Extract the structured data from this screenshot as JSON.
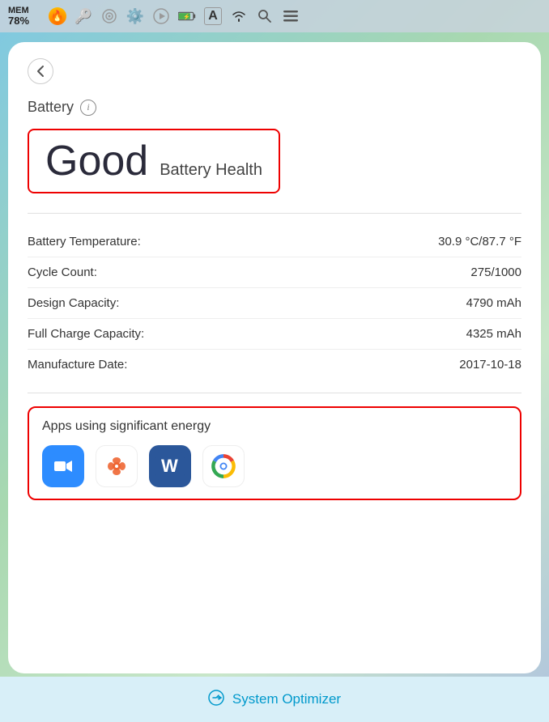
{
  "statusBar": {
    "mem": "MEM\n78%",
    "memLabel": "MEM",
    "memValue": "78%"
  },
  "header": {
    "backLabel": "‹",
    "title": "Battery",
    "infoIcon": "i"
  },
  "batteryHealth": {
    "status": "Good",
    "label": "Battery Health"
  },
  "stats": [
    {
      "label": "Battery Temperature:",
      "value": "30.9 °C/87.7 °F"
    },
    {
      "label": "Cycle Count:",
      "value": "275/1000"
    },
    {
      "label": "Design Capacity:",
      "value": "4790 mAh"
    },
    {
      "label": "Full Charge Capacity:",
      "value": "4325 mAh"
    },
    {
      "label": "Manufacture Date:",
      "value": "2017-10-18"
    }
  ],
  "appsSection": {
    "title": "Apps using significant energy",
    "apps": [
      {
        "name": "Zoom",
        "color": "#2d8cff"
      },
      {
        "name": "Baidu",
        "color": "#ffffff"
      },
      {
        "name": "Word",
        "color": "#2b579a"
      },
      {
        "name": "Chrome",
        "color": "#ffffff"
      }
    ]
  },
  "bottomBar": {
    "label": "System Optimizer",
    "icon": "→"
  }
}
